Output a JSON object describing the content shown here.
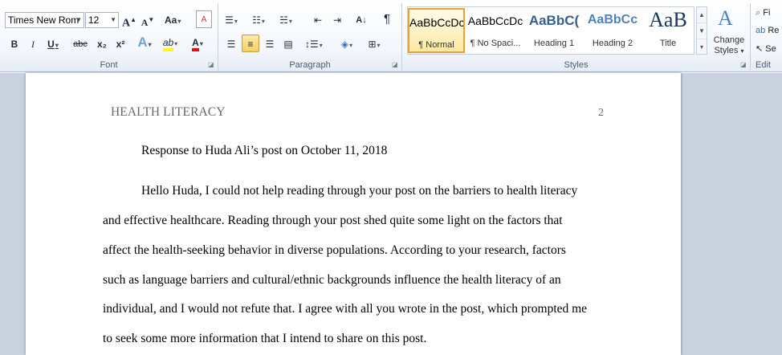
{
  "ribbon": {
    "font_group": {
      "label": "Font",
      "font_name": "Times New Rom",
      "font_size": "12",
      "grow_label": "A",
      "shrink_label": "A",
      "change_case_label": "Aa",
      "clear_label": "A",
      "bold_label": "B",
      "italic_label": "I",
      "underline_label": "U",
      "strike_label": "abc",
      "subscript_label": "x₂",
      "superscript_label": "x²",
      "effects_label": "A",
      "highlight_label": "ab",
      "font_color_label": "A"
    },
    "paragraph_group": {
      "label": "Paragraph",
      "pilcrow_label": "¶"
    },
    "styles_group": {
      "label": "Styles",
      "styles": [
        {
          "sample": "AaBbCcDc",
          "name": "¶ Normal"
        },
        {
          "sample": "AaBbCcDc",
          "name": "¶ No Spaci..."
        },
        {
          "sample": "AaBbC(",
          "name": "Heading 1"
        },
        {
          "sample": "AaBbCc",
          "name": "Heading 2"
        },
        {
          "sample": "AaB",
          "name": "Title"
        }
      ],
      "change_styles_line1": "Change",
      "change_styles_line2": "Styles"
    },
    "editing_group": {
      "label": "Edit",
      "find_label": "Fi",
      "replace_label": "Re",
      "select_label": "Se"
    }
  },
  "document": {
    "header_text": "HEALTH LITERACY",
    "page_number": "2",
    "lines": [
      "Response to Huda Ali’s post on October 11, 2018",
      "Hello Huda, I could not help reading through your post on the barriers to health literacy",
      "and effective healthcare. Reading through your post shed quite some light on the factors that",
      "affect the health-seeking behavior in diverse populations. According to your research, factors",
      "such as language barriers and cultural/ethnic backgrounds influence the health literacy of an",
      "individual, and I would not refute that. I agree with all you wrote in the post, which prompted me",
      "to seek some more information that I intend to share on this post."
    ]
  },
  "colors": {
    "accent_selected": "#f8cf63",
    "heading_blue": "#365f91",
    "font_color_red": "#e01010",
    "highlight_yellow": "#ffff00"
  }
}
